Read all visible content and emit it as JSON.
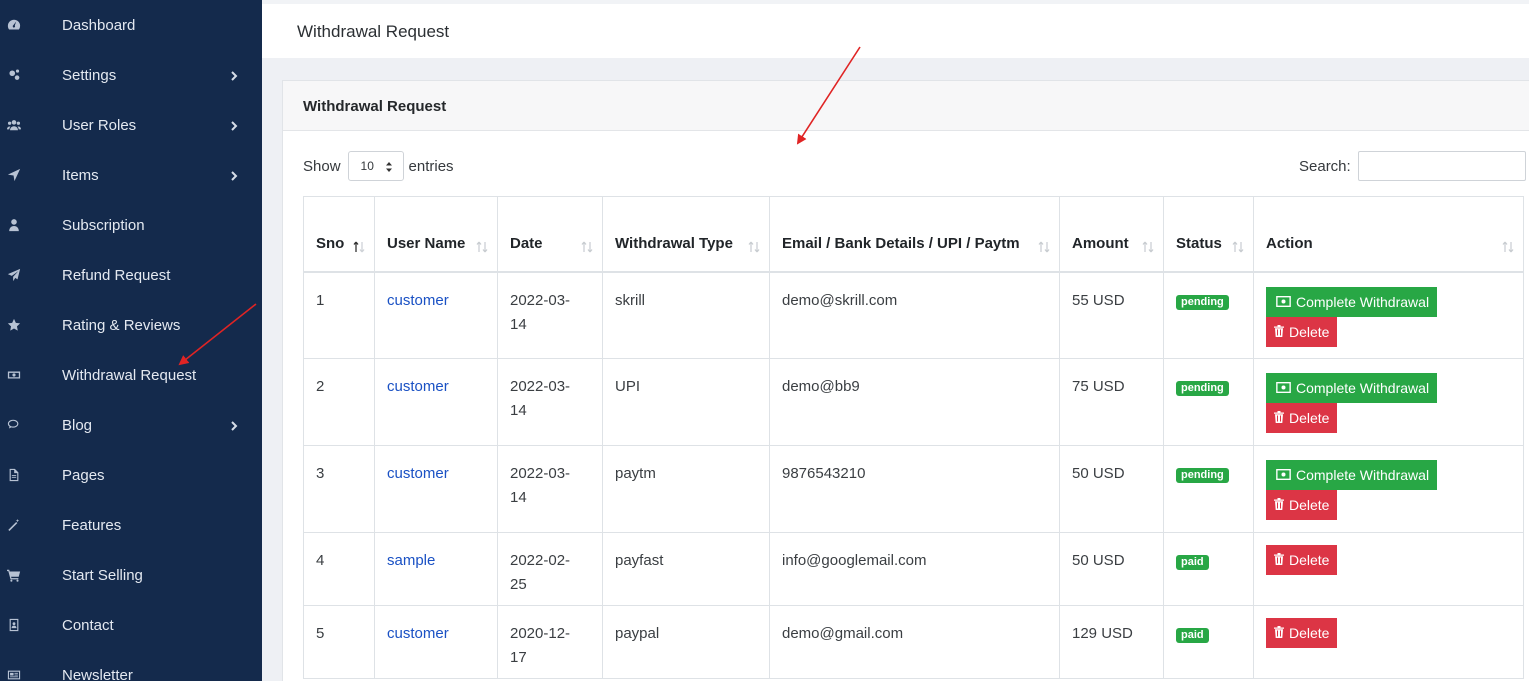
{
  "sidebar": {
    "items": [
      {
        "label": "Dashboard",
        "icon": "gauge-icon",
        "has_children": false
      },
      {
        "label": "Settings",
        "icon": "gears-icon",
        "has_children": true
      },
      {
        "label": "User Roles",
        "icon": "users-icon",
        "has_children": true
      },
      {
        "label": "Items",
        "icon": "location-arrow-icon",
        "has_children": true
      },
      {
        "label": "Subscription",
        "icon": "user-icon",
        "has_children": false
      },
      {
        "label": "Refund Request",
        "icon": "paper-plane-icon",
        "has_children": false
      },
      {
        "label": "Rating & Reviews",
        "icon": "star-icon",
        "has_children": false
      },
      {
        "label": "Withdrawal Request",
        "icon": "money-bill-icon",
        "has_children": false
      },
      {
        "label": "Blog",
        "icon": "comments-icon",
        "has_children": true
      },
      {
        "label": "Pages",
        "icon": "file-icon",
        "has_children": false
      },
      {
        "label": "Features",
        "icon": "magic-wand-icon",
        "has_children": false
      },
      {
        "label": "Start Selling",
        "icon": "cart-icon",
        "has_children": false
      },
      {
        "label": "Contact",
        "icon": "address-book-icon",
        "has_children": false
      },
      {
        "label": "Newsletter",
        "icon": "newspaper-icon",
        "has_children": false
      }
    ]
  },
  "header": {
    "title": "Withdrawal Request"
  },
  "card": {
    "title": "Withdrawal Request"
  },
  "controls": {
    "show_label": "Show",
    "entries_value": "10",
    "entries_label": "entries",
    "search_label": "Search:",
    "search_value": ""
  },
  "table": {
    "columns": [
      "Sno",
      "User Name",
      "Date",
      "Withdrawal Type",
      "Email / Bank Details / UPI / Paytm",
      "Amount",
      "Status",
      "Action"
    ],
    "rows": [
      {
        "sno": "1",
        "user": "customer",
        "date": "2022-03-14",
        "type": "skrill",
        "details": "demo@skrill.com",
        "amount": "55 USD",
        "status": "pending",
        "complete": true
      },
      {
        "sno": "2",
        "user": "customer",
        "date": "2022-03-14",
        "type": "UPI",
        "details": "demo@bb9",
        "amount": "75 USD",
        "status": "pending",
        "complete": true
      },
      {
        "sno": "3",
        "user": "customer",
        "date": "2022-03-14",
        "type": "paytm",
        "details": "9876543210",
        "amount": "50 USD",
        "status": "pending",
        "complete": true
      },
      {
        "sno": "4",
        "user": "sample",
        "date": "2022-02-25",
        "type": "payfast",
        "details": "info@googlemail.com",
        "amount": "50 USD",
        "status": "paid",
        "complete": false
      },
      {
        "sno": "5",
        "user": "customer",
        "date": "2020-12-17",
        "type": "paypal",
        "details": "demo@gmail.com",
        "amount": "129 USD",
        "status": "paid",
        "complete": false
      }
    ],
    "complete_label": "Complete Withdrawal",
    "delete_label": "Delete"
  },
  "colors": {
    "sidebar_bg": "#142a4c",
    "success": "#28a745",
    "danger": "#dc3545",
    "link": "#1a51c4",
    "annotation_arrow": "#e02424"
  }
}
